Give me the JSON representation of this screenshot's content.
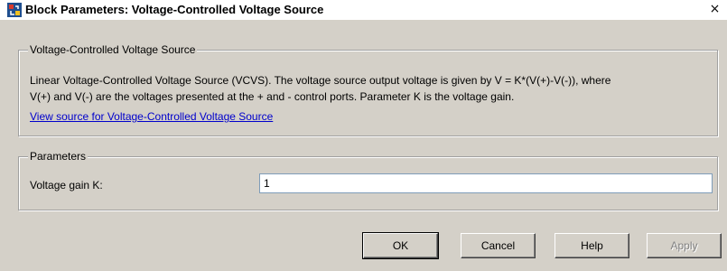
{
  "window": {
    "title": "Block Parameters: Voltage-Controlled Voltage Source",
    "close_glyph": "×"
  },
  "description_group": {
    "legend": "Voltage-Controlled Voltage Source",
    "text_line1": "Linear Voltage-Controlled Voltage Source (VCVS). The voltage source output voltage is given by V = K*(V(+)-V(-)), where",
    "text_line2": "V(+) and V(-) are the voltages presented at the + and - control ports. Parameter K is the voltage gain.",
    "link_text": "View source for Voltage-Controlled Voltage Source"
  },
  "parameters_group": {
    "legend": "Parameters",
    "voltage_gain_label": "Voltage gain K:",
    "voltage_gain_value": "1"
  },
  "buttons": {
    "ok": "OK",
    "cancel": "Cancel",
    "help": "Help",
    "apply": "Apply"
  },
  "colors": {
    "dialog_background": "#d4d0c8",
    "link": "#0000cc",
    "disabled_text": "#808080"
  }
}
